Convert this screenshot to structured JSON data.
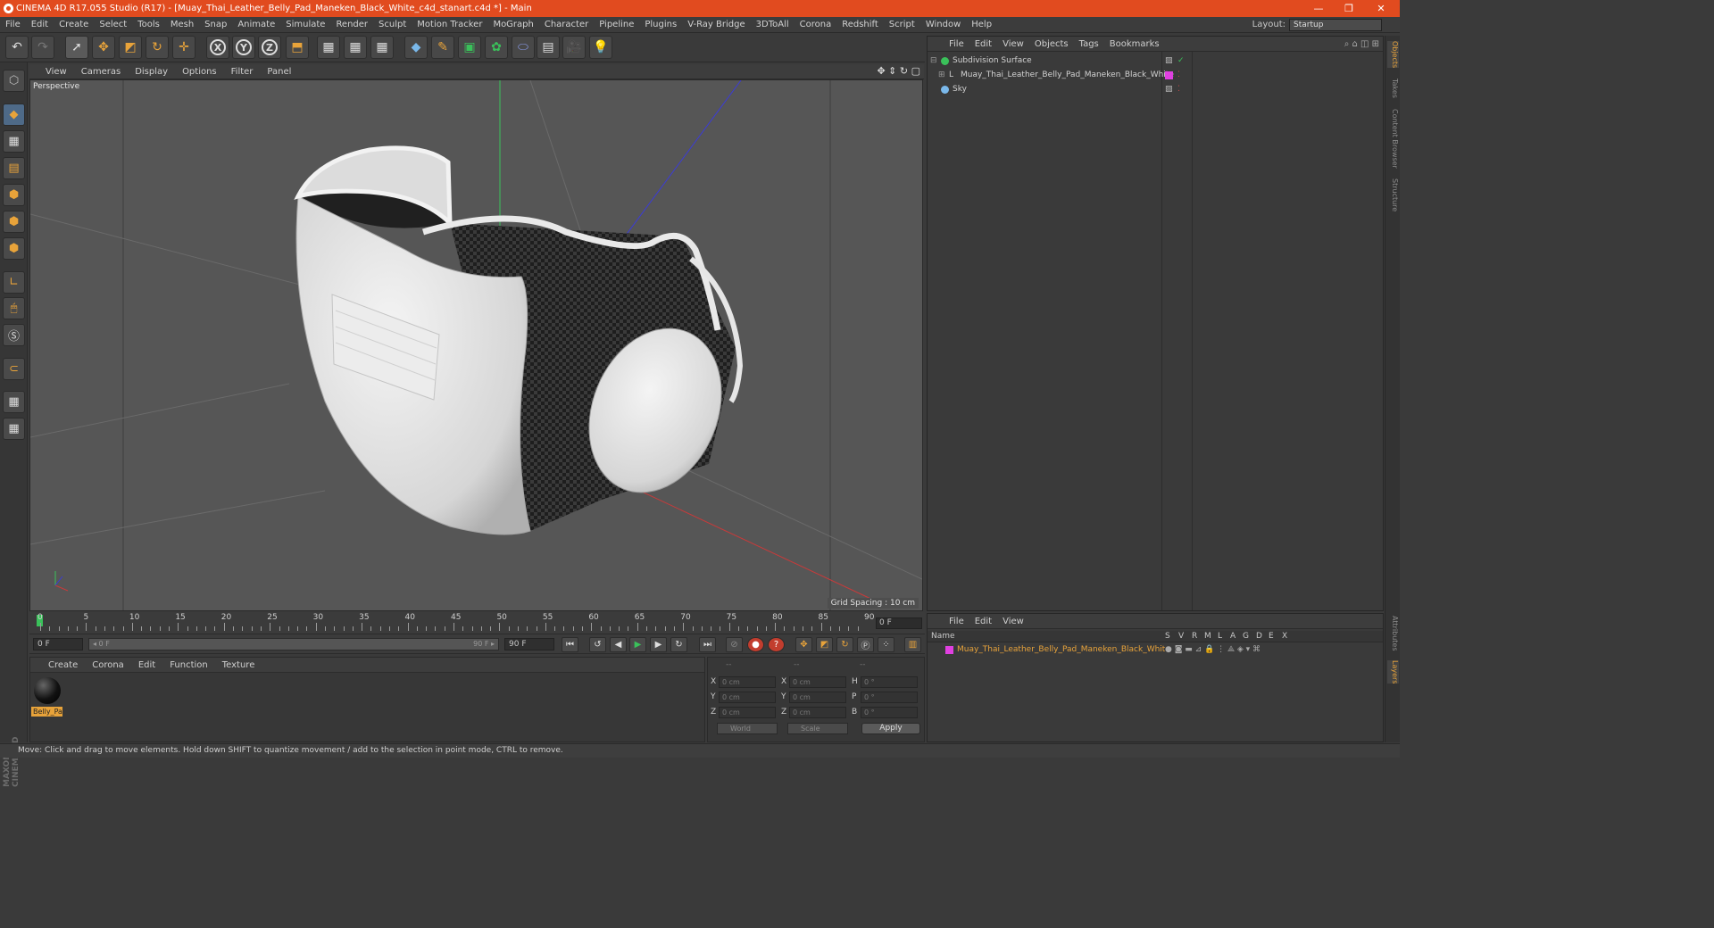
{
  "window": {
    "title": "CINEMA 4D R17.055 Studio (R17) - [Muay_Thai_Leather_Belly_Pad_Maneken_Black_White_c4d_stanart.c4d *] - Main",
    "minimize": "—",
    "restore": "❐",
    "close": "✕"
  },
  "menu": [
    "File",
    "Edit",
    "Create",
    "Select",
    "Tools",
    "Mesh",
    "Snap",
    "Animate",
    "Simulate",
    "Render",
    "Sculpt",
    "Motion Tracker",
    "MoGraph",
    "Character",
    "Pipeline",
    "Plugins",
    "V-Ray Bridge",
    "3DToAll",
    "Corona",
    "Redshift",
    "Script",
    "Window",
    "Help"
  ],
  "layout": {
    "label": "Layout:",
    "value": "Startup"
  },
  "viewport": {
    "menu": [
      "View",
      "Cameras",
      "Display",
      "Options",
      "Filter",
      "Panel"
    ],
    "label": "Perspective",
    "grid_spacing": "Grid Spacing : 10 cm"
  },
  "timeline": {
    "ticks": [
      "0",
      "5",
      "10",
      "15",
      "20",
      "25",
      "30",
      "35",
      "40",
      "45",
      "50",
      "55",
      "60",
      "65",
      "70",
      "75",
      "80",
      "85",
      "90"
    ],
    "current_frame": "0 F",
    "start_field": "0 F",
    "slider_start": "◂ 0 F",
    "slider_end": "90 F ▸",
    "end_field": "90 F"
  },
  "materials": {
    "menu": [
      "Create",
      "Corona",
      "Edit",
      "Function",
      "Texture"
    ],
    "items": [
      {
        "name": "Belly_Pa"
      }
    ]
  },
  "coordinates": {
    "headers": [
      "--",
      "--",
      "--"
    ],
    "rows": [
      {
        "a": "X",
        "av": "0 cm",
        "b": "X",
        "bv": "0 cm",
        "c": "H",
        "cv": "0 °"
      },
      {
        "a": "Y",
        "av": "0 cm",
        "b": "Y",
        "bv": "0 cm",
        "c": "P",
        "cv": "0 °"
      },
      {
        "a": "Z",
        "av": "0 cm",
        "b": "Z",
        "bv": "0 cm",
        "c": "B",
        "cv": "0 °"
      }
    ],
    "mode": "World",
    "transform": "Scale",
    "apply": "Apply"
  },
  "objects": {
    "menu": [
      "File",
      "Edit",
      "View",
      "Objects",
      "Tags",
      "Bookmarks"
    ],
    "items": [
      {
        "name": "Subdivision Surface"
      },
      {
        "name": "Muay_Thai_Leather_Belly_Pad_Maneken_Black_White"
      },
      {
        "name": "Sky"
      }
    ]
  },
  "layers": {
    "menu": [
      "File",
      "Edit",
      "View"
    ],
    "header_name": "Name",
    "header_cols": [
      "S",
      "V",
      "R",
      "M",
      "L",
      "A",
      "G",
      "D",
      "E",
      "X"
    ],
    "items": [
      {
        "name": "Muay_Thai_Leather_Belly_Pad_Maneken_Black_White"
      }
    ]
  },
  "side_tabs": [
    "Objects",
    "Takes",
    "Content Browser",
    "Structure"
  ],
  "side_tabs_bottom": [
    "Attributes",
    "Layers"
  ],
  "status": "Move: Click and drag to move elements. Hold down SHIFT to quantize movement / add to the selection in point mode, CTRL to remove.",
  "maxon": "MAXON CINEMA 4D",
  "colors": {
    "accent": "#e8a33a",
    "title_bar": "#e14b1f",
    "layer_color": "#e040e0"
  }
}
